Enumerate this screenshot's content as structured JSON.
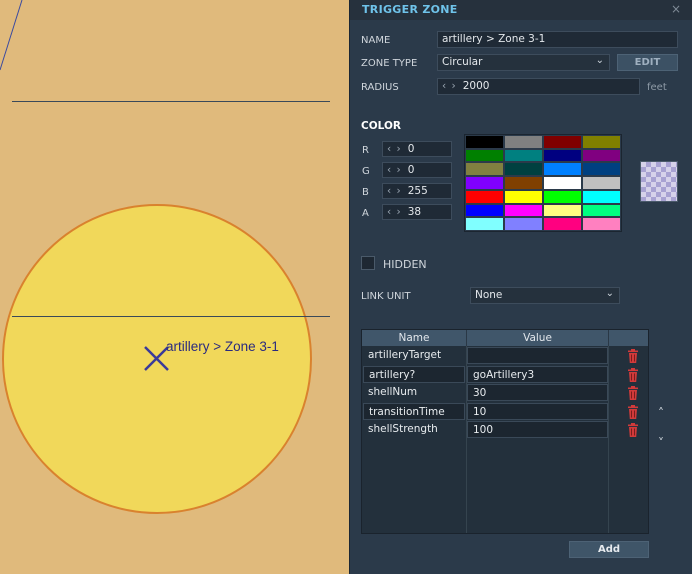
{
  "map": {
    "zone_label": "artillery > Zone 3-1"
  },
  "panel": {
    "title": "TRIGGER ZONE",
    "close_glyph": "×",
    "name_label": "NAME",
    "name_value": "artillery > Zone 3-1",
    "zone_type_label": "ZONE TYPE",
    "zone_type_value": "Circular",
    "edit_label": "EDIT",
    "radius_label": "RADIUS",
    "radius_value": "2000",
    "radius_unit": "feet",
    "color_title": "COLOR",
    "r_label": "R",
    "r_value": "0",
    "g_label": "G",
    "g_value": "0",
    "b_label": "B",
    "b_value": "255",
    "a_label": "A",
    "a_value": "38",
    "stepper_arrows": "‹ ›",
    "hidden_label": "HIDDEN",
    "link_unit_label": "LINK UNIT",
    "link_unit_value": "None",
    "table": {
      "col_name": "Name",
      "col_value": "Value",
      "rows": [
        {
          "name": "artilleryTarget",
          "value": ""
        },
        {
          "name": "artillery?",
          "value": "goArtillery3"
        },
        {
          "name": "shellNum",
          "value": "30"
        },
        {
          "name": "transitionTime",
          "value": "10"
        },
        {
          "name": "shellStrength",
          "value": "100"
        }
      ]
    },
    "add_label": "Add",
    "scroll_up": "˄",
    "scroll_down": "˅"
  },
  "swatches": [
    "#000000",
    "#808080",
    "#800000",
    "#808000",
    "#008000",
    "#008080",
    "#000080",
    "#800080",
    "#808040",
    "#004040",
    "#0080ff",
    "#004080",
    "#8000ff",
    "#804000",
    "#ffffff",
    "#c0c0c0",
    "#ff0000",
    "#ffff00",
    "#00ff00",
    "#00ffff",
    "#0000ff",
    "#ff00ff",
    "#ffff80",
    "#00ff80",
    "#80ffff",
    "#8080ff",
    "#ff0080",
    "#ff80c0"
  ],
  "colors": {
    "accent": "#6fc3ea",
    "zone_fill": "#f1d85a",
    "zone_stroke": "#d9822e",
    "marker": "#3a3a9a",
    "trash": "#d23a3a"
  }
}
